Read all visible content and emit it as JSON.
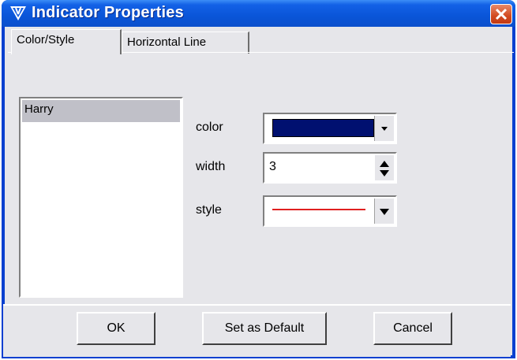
{
  "window": {
    "title": "Indicator Properties"
  },
  "tabs": [
    {
      "label": "Color/Style"
    },
    {
      "label": "Horizontal Line"
    }
  ],
  "list": {
    "items": [
      "Harry"
    ],
    "selected": "Harry"
  },
  "form": {
    "color_label": "color",
    "color_value": "#001070",
    "width_label": "width",
    "width_value": "3",
    "style_label": "style",
    "style_line_color": "#e02020"
  },
  "buttons": {
    "ok": "OK",
    "set_default": "Set as Default",
    "cancel": "Cancel"
  }
}
